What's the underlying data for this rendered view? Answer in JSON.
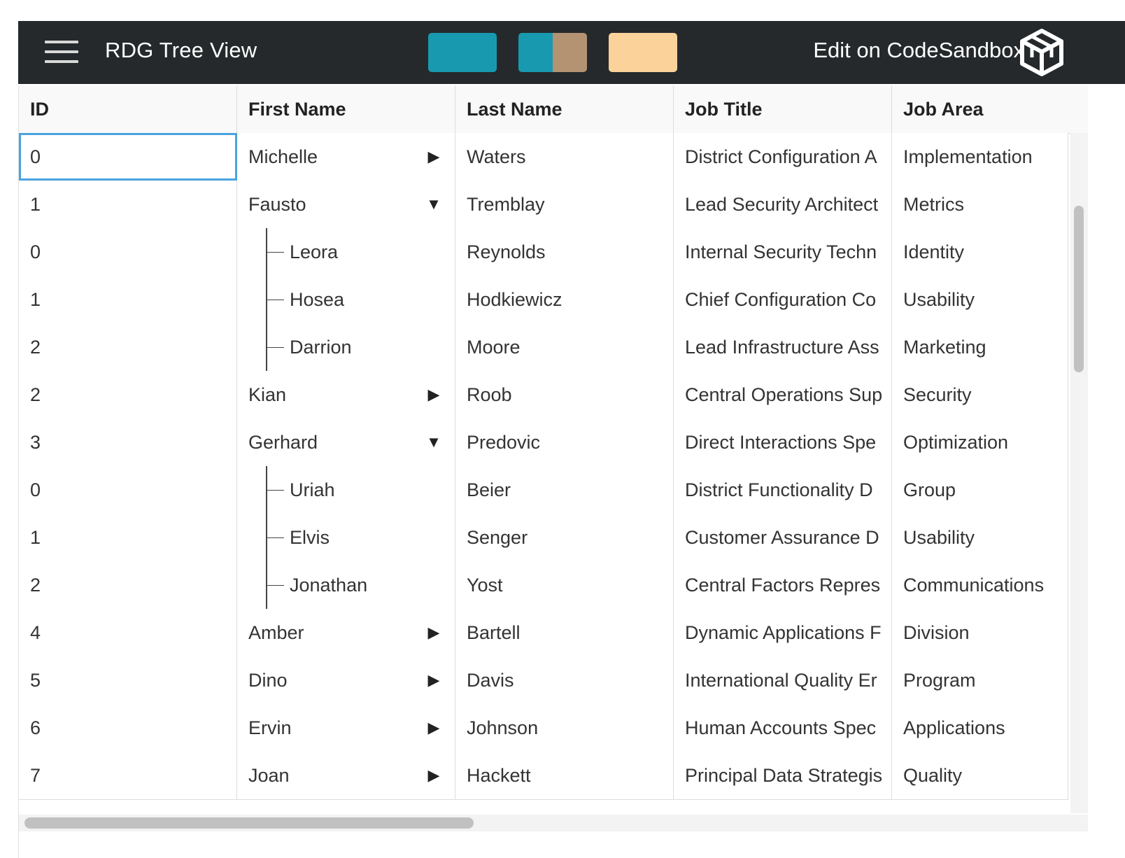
{
  "header": {
    "title": "RDG Tree View",
    "edit_link": "Edit on CodeSandbox",
    "menu_icon": "hamburger-menu-icon",
    "logo_icon": "codesandbox-cube-icon",
    "background_color": "#25292b",
    "theme_swatches": [
      {
        "name": "teal-theme",
        "colors": [
          "#1899b0"
        ]
      },
      {
        "name": "teal-tan-theme",
        "colors": [
          "#1899b0",
          "#b39371"
        ]
      },
      {
        "name": "peach-theme",
        "colors": [
          "#fcd29b"
        ]
      }
    ]
  },
  "grid": {
    "columns": [
      "ID",
      "First Name",
      "Last Name",
      "Job Title",
      "Job Area"
    ],
    "selected_cell": {
      "row": 0,
      "column": "ID",
      "color": "#4aa3df"
    },
    "rows": [
      {
        "id": "0",
        "first": "Michelle",
        "last": "Waters",
        "title": "District Configuration A",
        "area": "Implementation",
        "level": 0,
        "toggle": "▶"
      },
      {
        "id": "1",
        "first": "Fausto",
        "last": "Tremblay",
        "title": "Lead Security Architect",
        "area": "Metrics",
        "level": 0,
        "toggle": "▼"
      },
      {
        "id": "0",
        "first": "Leora",
        "last": "Reynolds",
        "title": "Internal Security Techn",
        "area": "Identity",
        "level": 1,
        "toggle": ""
      },
      {
        "id": "1",
        "first": "Hosea",
        "last": "Hodkiewicz",
        "title": "Chief Configuration Co",
        "area": "Usability",
        "level": 1,
        "toggle": ""
      },
      {
        "id": "2",
        "first": "Darrion",
        "last": "Moore",
        "title": "Lead Infrastructure Ass",
        "area": "Marketing",
        "level": 1,
        "toggle": ""
      },
      {
        "id": "2",
        "first": "Kian",
        "last": "Roob",
        "title": "Central Operations Sup",
        "area": "Security",
        "level": 0,
        "toggle": "▶"
      },
      {
        "id": "3",
        "first": "Gerhard",
        "last": "Predovic",
        "title": "Direct Interactions Spe",
        "area": "Optimization",
        "level": 0,
        "toggle": "▼"
      },
      {
        "id": "0",
        "first": "Uriah",
        "last": "Beier",
        "title": "District Functionality D",
        "area": "Group",
        "level": 1,
        "toggle": ""
      },
      {
        "id": "1",
        "first": "Elvis",
        "last": "Senger",
        "title": "Customer Assurance D",
        "area": "Usability",
        "level": 1,
        "toggle": ""
      },
      {
        "id": "2",
        "first": "Jonathan",
        "last": "Yost",
        "title": "Central Factors Repres",
        "area": "Communications",
        "level": 1,
        "toggle": ""
      },
      {
        "id": "4",
        "first": "Amber",
        "last": "Bartell",
        "title": "Dynamic Applications F",
        "area": "Division",
        "level": 0,
        "toggle": "▶"
      },
      {
        "id": "5",
        "first": "Dino",
        "last": "Davis",
        "title": "International Quality Er",
        "area": "Program",
        "level": 0,
        "toggle": "▶"
      },
      {
        "id": "6",
        "first": "Ervin",
        "last": "Johnson",
        "title": "Human Accounts Spec",
        "area": "Applications",
        "level": 0,
        "toggle": "▶"
      },
      {
        "id": "7",
        "first": "Joan",
        "last": "Hackett",
        "title": "Principal Data Strategis",
        "area": "Quality",
        "level": 0,
        "toggle": "▶"
      }
    ]
  }
}
